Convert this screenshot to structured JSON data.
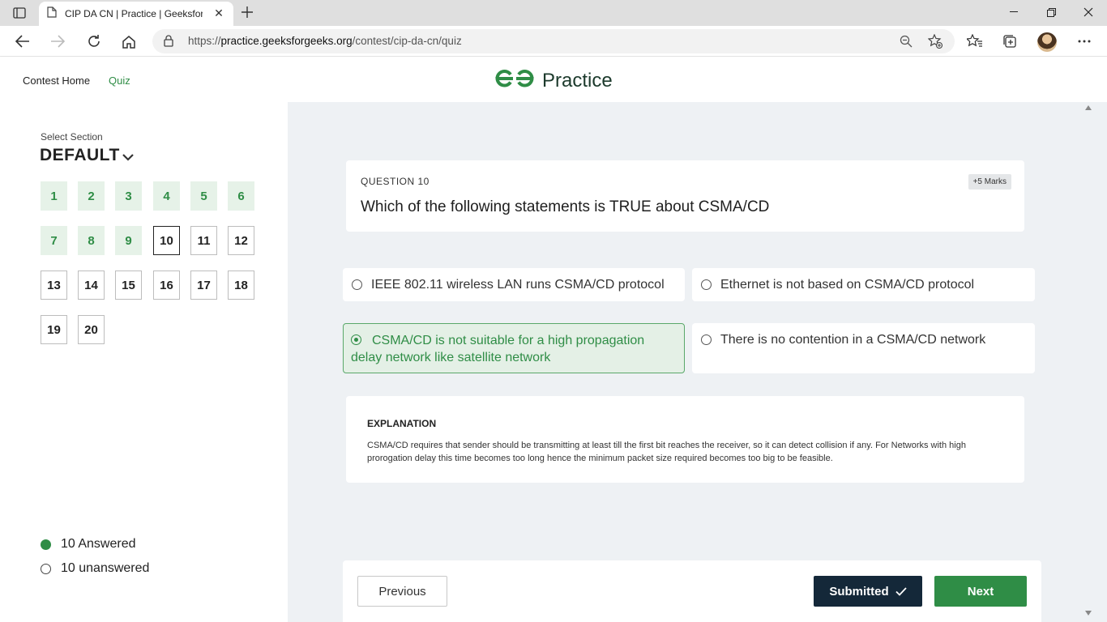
{
  "browser": {
    "tab_title": "CIP DA CN | Practice | GeeksforG",
    "url_prefix": "https://",
    "url_host": "practice.geeksforgeeks.org",
    "url_path": "/contest/cip-da-cn/quiz"
  },
  "header": {
    "contest_home": "Contest Home",
    "quiz": "Quiz",
    "logo_text": "Practice",
    "active_color": "#2f8d46"
  },
  "sidebar": {
    "select_label": "Select Section",
    "section": "DEFAULT",
    "questions": [
      {
        "n": "1",
        "state": "answered"
      },
      {
        "n": "2",
        "state": "answered"
      },
      {
        "n": "3",
        "state": "answered"
      },
      {
        "n": "4",
        "state": "answered"
      },
      {
        "n": "5",
        "state": "answered"
      },
      {
        "n": "6",
        "state": "answered"
      },
      {
        "n": "7",
        "state": "answered"
      },
      {
        "n": "8",
        "state": "answered"
      },
      {
        "n": "9",
        "state": "answered"
      },
      {
        "n": "10",
        "state": "current"
      },
      {
        "n": "11",
        "state": "unanswered"
      },
      {
        "n": "12",
        "state": "unanswered"
      },
      {
        "n": "13",
        "state": "unanswered"
      },
      {
        "n": "14",
        "state": "unanswered"
      },
      {
        "n": "15",
        "state": "unanswered"
      },
      {
        "n": "16",
        "state": "unanswered"
      },
      {
        "n": "17",
        "state": "unanswered"
      },
      {
        "n": "18",
        "state": "unanswered"
      },
      {
        "n": "19",
        "state": "unanswered"
      },
      {
        "n": "20",
        "state": "unanswered"
      }
    ],
    "answered_label": "10 Answered",
    "unanswered_label": "10 unanswered"
  },
  "question": {
    "number_label": "QUESTION 10",
    "marks": "+5 Marks",
    "text": "Which of the following statements is TRUE about CSMA/CD",
    "options": [
      {
        "text": "IEEE 802.11 wireless LAN runs CSMA/CD protocol",
        "selected": false
      },
      {
        "text": "Ethernet is not based on CSMA/CD protocol",
        "selected": false
      },
      {
        "text": "CSMA/CD is not suitable for a high propagation delay network like satellite network",
        "selected": true
      },
      {
        "text": "There is no contention in a CSMA/CD network",
        "selected": false
      }
    ]
  },
  "explanation": {
    "title": "EXPLANATION",
    "text": "CSMA/CD requires that sender should be transmitting at least till the first bit reaches the receiver, so it can detect collision if any. For Networks with high prorogation delay this time becomes too long hence the minimum packet size required becomes too big to be feasible."
  },
  "footer": {
    "previous": "Previous",
    "submitted": "Submitted",
    "next": "Next"
  }
}
